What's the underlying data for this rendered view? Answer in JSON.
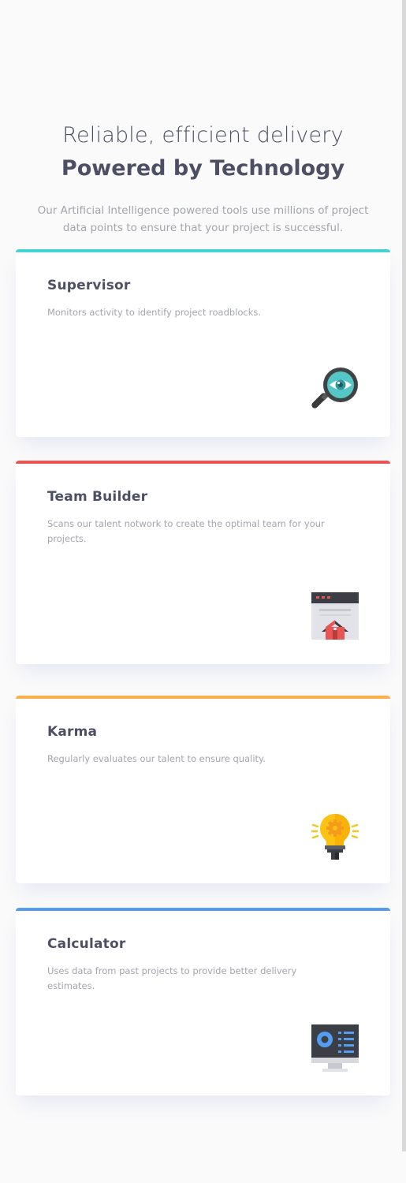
{
  "header": {
    "title_light": "Reliable, efficient delivery",
    "title_bold": "Powered by Technology",
    "intro": "Our Artificial Intelligence powered tools use millions of project data points to ensure that your project is successful."
  },
  "cards": [
    {
      "title": "Supervisor",
      "description": "Monitors activity to identify project roadblocks.",
      "accent": "#44d3d2",
      "icon": "magnifier-eye-icon"
    },
    {
      "title": "Team Builder",
      "description": "Scans our talent notwork to create the optimal team for your projects.",
      "accent": "#ea5454",
      "icon": "browser-house-icon"
    },
    {
      "title": "Karma",
      "description": "Regularly evaluates our talent to ensure quality.",
      "accent": "#fcae4a",
      "icon": "lightbulb-gear-icon"
    },
    {
      "title": "Calculator",
      "description": "Uses data from past projects to provide better delivery estimates.",
      "accent": "#549ef2",
      "icon": "monitor-chart-icon"
    }
  ]
}
